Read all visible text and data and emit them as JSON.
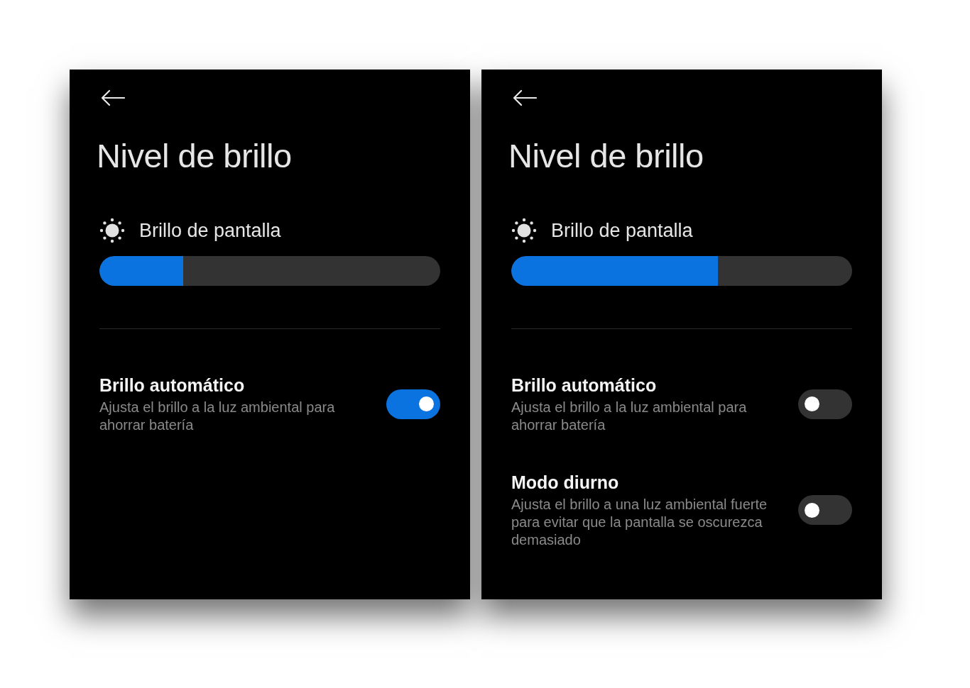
{
  "screens": [
    {
      "title": "Nivel de brillo",
      "brightness": {
        "label": "Brillo de pantalla",
        "level": 0.245
      },
      "settings": [
        {
          "title": "Brillo automático",
          "description": "Ajusta el brillo a la luz ambiental para ahorrar batería",
          "on": true
        }
      ]
    },
    {
      "title": "Nivel de brillo",
      "brightness": {
        "label": "Brillo de pantalla",
        "level": 0.607
      },
      "settings": [
        {
          "title": "Brillo automático",
          "description": "Ajusta el brillo a la luz ambiental para ahorrar batería",
          "on": false
        },
        {
          "title": "Modo diurno",
          "description": "Ajusta el brillo a una luz ambiental fuerte para evitar que la pantalla se oscurezca demasiado",
          "on": false
        }
      ]
    }
  ]
}
